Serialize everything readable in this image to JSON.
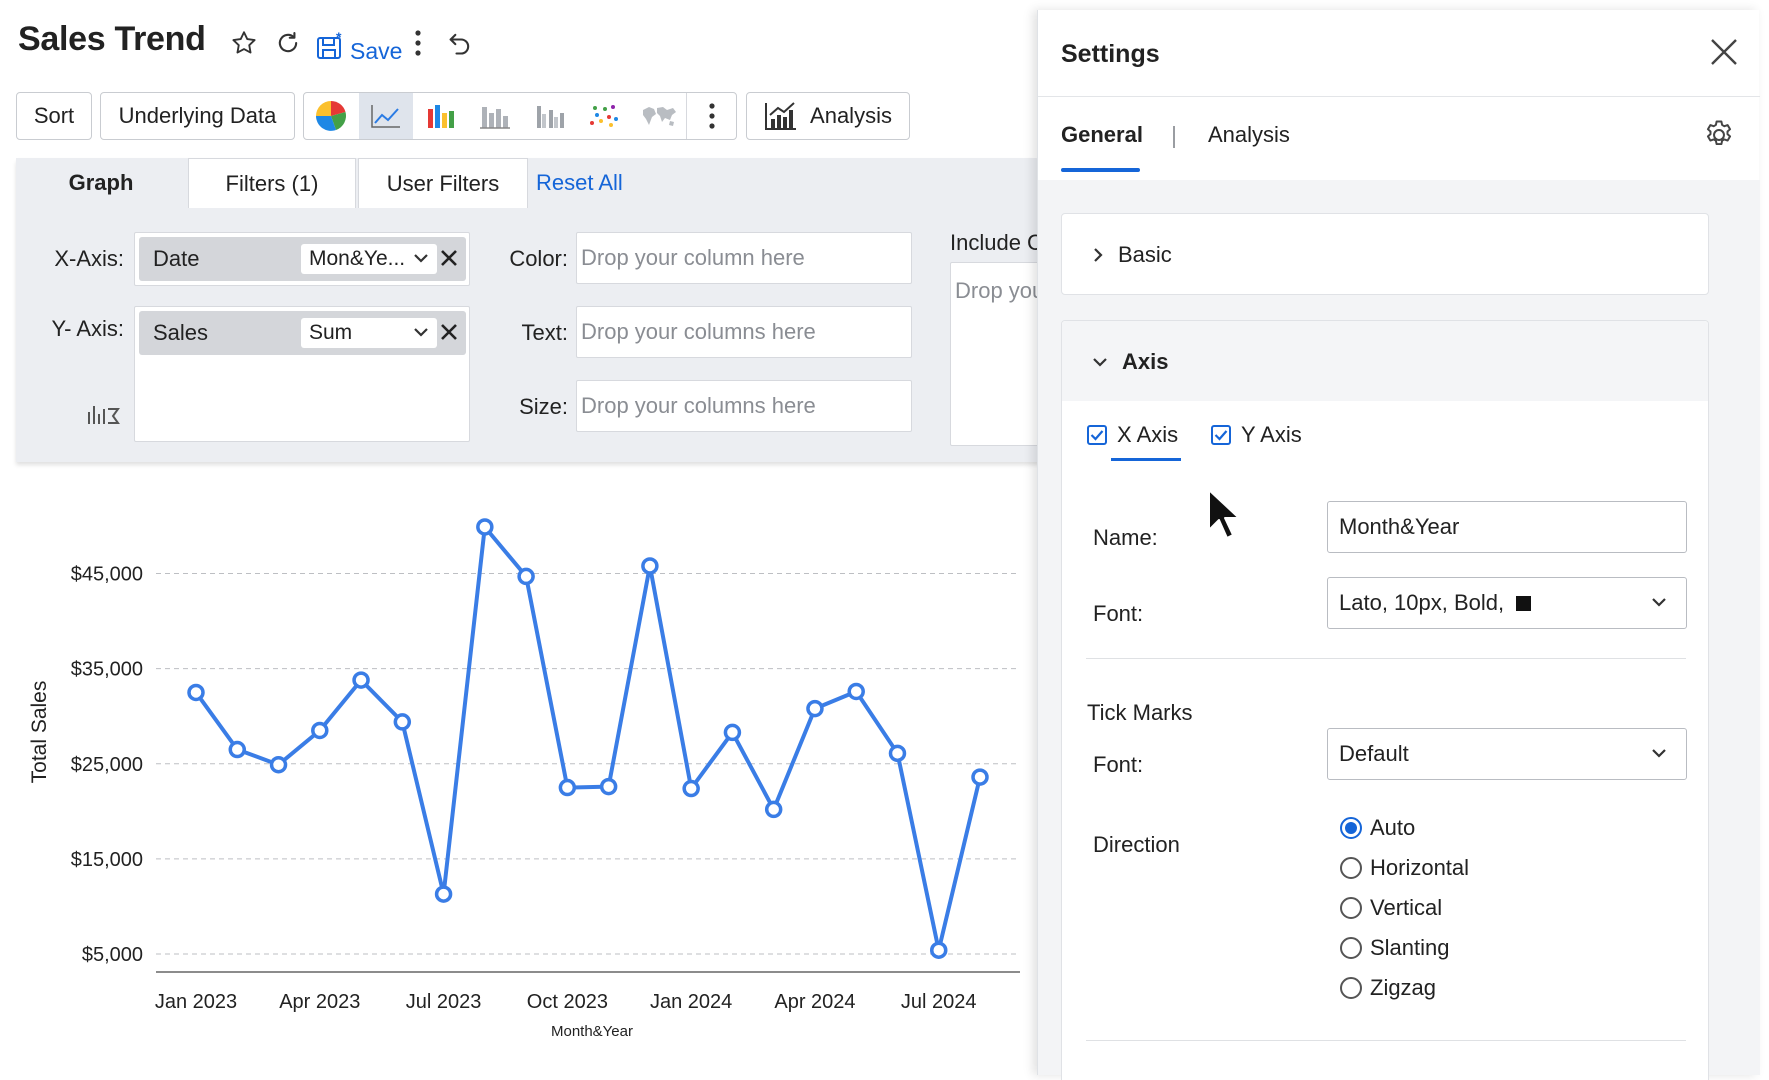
{
  "header": {
    "title": "Sales Trend",
    "save_label": "Save",
    "accent_color": "#1565d8"
  },
  "toolbar": {
    "sort_label": "Sort",
    "underlying_label": "Underlying Data",
    "analysis_label": "Analysis",
    "chart_types": [
      "pie-chart-icon",
      "line-chart-icon",
      "bar-chart-icon",
      "stacked-bar-icon",
      "grouped-bar-icon",
      "scatter-icon",
      "map-icon"
    ],
    "active_chart_type": "line-chart-icon"
  },
  "tabs": {
    "graph": "Graph",
    "filters": "Filters  (1)",
    "user_filters": "User Filters",
    "reset_all": "Reset All"
  },
  "shelves": {
    "x_axis_label": "X-Axis:",
    "y_axis_label": "Y- Axis:",
    "x_field": "Date",
    "x_func": "Mon&Ye...",
    "y_field": "Sales",
    "y_func": "Sum",
    "color_label": "Color:",
    "text_label": "Text:",
    "size_label": "Size:",
    "color_placeholder": "Drop your column here",
    "text_placeholder": "Drop your columns here",
    "size_placeholder": "Drop your columns here",
    "include_label": "Include C",
    "include_placeholder": "Drop you"
  },
  "chart_data": {
    "type": "line",
    "xlabel": "Month&Year",
    "ylabel": "Total Sales",
    "x_tick_labels": [
      "Jan 2023",
      "Apr 2023",
      "Jul 2023",
      "Oct 2023",
      "Jan 2024",
      "Apr 2024",
      "Jul 2024"
    ],
    "x": [
      "Jan 2023",
      "Feb 2023",
      "Mar 2023",
      "Apr 2023",
      "May 2023",
      "Jun 2023",
      "Jul 2023",
      "Aug 2023",
      "Sep 2023",
      "Oct 2023",
      "Nov 2023",
      "Dec 2023",
      "Jan 2024",
      "Feb 2024",
      "Mar 2024",
      "Apr 2024",
      "May 2024",
      "Jun 2024",
      "Jul 2024",
      "Aug 2024"
    ],
    "y_tick_labels": [
      "$5,000",
      "$15,000",
      "$25,000",
      "$35,000",
      "$45,000"
    ],
    "y_ticks": [
      5000,
      15000,
      25000,
      35000,
      45000
    ],
    "ylim": [
      5000,
      50000
    ],
    "grid": true,
    "series_color": "#3a7de6",
    "values": [
      32500,
      26500,
      24900,
      28500,
      33800,
      29400,
      11300,
      49900,
      44700,
      22500,
      22600,
      45800,
      22400,
      28300,
      20200,
      30800,
      32600,
      26100,
      5400,
      23600
    ]
  },
  "settings": {
    "title": "Settings",
    "tab_general": "General",
    "tab_analysis": "Analysis",
    "basic_label": "Basic",
    "axis_label": "Axis",
    "x_axis_check": "X Axis",
    "y_axis_check": "Y Axis",
    "name_label": "Name:",
    "name_value": "Month&Year",
    "font_label": "Font:",
    "font_value": "Lato, 10px, Bold,",
    "tick_marks_label": "Tick Marks",
    "tick_font_label": "Font:",
    "tick_font_value": "Default",
    "direction_label": "Direction",
    "direction_options": [
      "Auto",
      "Horizontal",
      "Vertical",
      "Slanting",
      "Zigzag"
    ],
    "direction_selected": "Auto"
  }
}
